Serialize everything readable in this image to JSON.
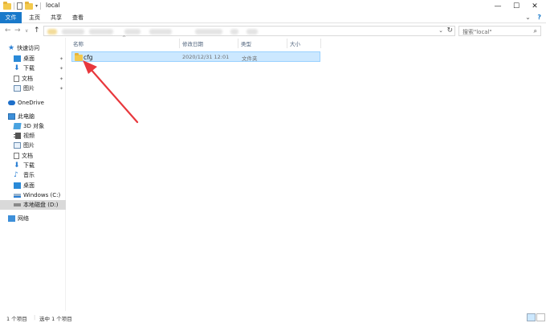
{
  "window": {
    "title": "local",
    "buttons": {
      "minimize": "—",
      "maximize": "☐",
      "close": "✕"
    }
  },
  "ribbon": {
    "tabs": [
      "文件",
      "主页",
      "共享",
      "查看"
    ],
    "expand_glyph": "⌄",
    "help_glyph": "?"
  },
  "address": {
    "nav": {
      "back": "←",
      "forward": "→",
      "dropdown": "∨",
      "up": "↑"
    },
    "dropdown_glyph": "⌄",
    "refresh_glyph": "↻"
  },
  "search": {
    "placeholder": "搜索\"local\"",
    "icon_glyph": "⌕"
  },
  "sidebar": {
    "quick_access": "快速访问",
    "quick_items": [
      {
        "label": "桌面",
        "icon": "desktop-icon",
        "pinned": true
      },
      {
        "label": "下载",
        "icon": "download-icon",
        "pinned": true
      },
      {
        "label": "文档",
        "icon": "document-icon",
        "pinned": true
      },
      {
        "label": "图片",
        "icon": "picture-icon",
        "pinned": true
      }
    ],
    "onedrive": "OneDrive",
    "this_pc": "此电脑",
    "pc_items": [
      {
        "label": "3D 对象",
        "icon": "3d-objects-icon"
      },
      {
        "label": "视频",
        "icon": "video-icon"
      },
      {
        "label": "图片",
        "icon": "picture-icon"
      },
      {
        "label": "文档",
        "icon": "document-icon"
      },
      {
        "label": "下载",
        "icon": "download-icon"
      },
      {
        "label": "音乐",
        "icon": "music-icon"
      },
      {
        "label": "桌面",
        "icon": "desktop-icon"
      },
      {
        "label": "Windows (C:)",
        "icon": "drive-icon"
      },
      {
        "label": "本地磁盘 (D:)",
        "icon": "drive-icon",
        "selected": true
      }
    ],
    "network": "网络"
  },
  "columns": {
    "name": "名称",
    "date": "修改日期",
    "type": "类型",
    "size": "大小",
    "sort_glyph": "^"
  },
  "files": [
    {
      "name": "cfg",
      "date": "2020/12/31 12:01",
      "type": "文件夹",
      "size": "",
      "selected": true
    }
  ],
  "status": {
    "count": "1 个项目",
    "selected": "选中 1 个项目"
  },
  "colors": {
    "accent": "#1979ca",
    "selection": "#cce8ff",
    "folder": "#f3c94c",
    "arrow": "#e8383d"
  }
}
